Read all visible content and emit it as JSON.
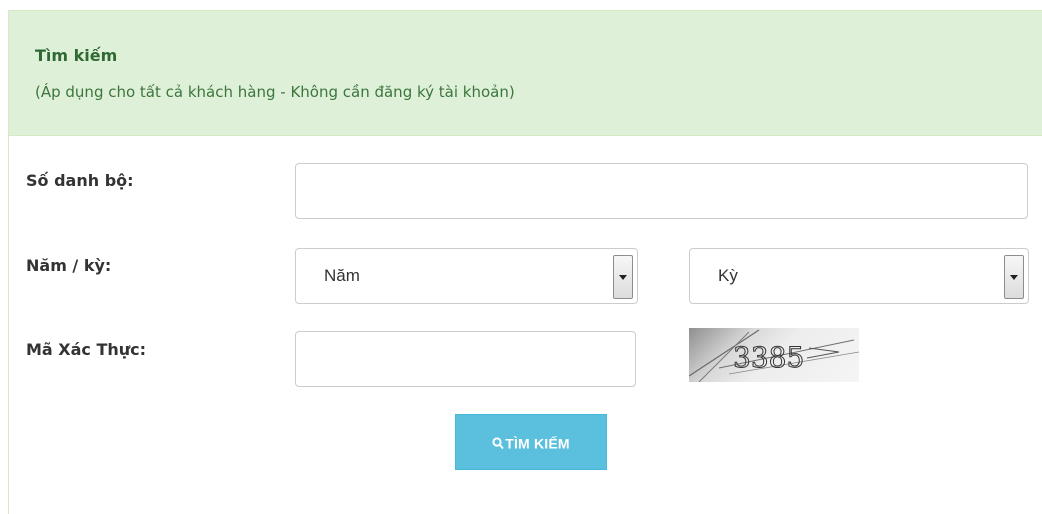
{
  "panel": {
    "title": "Tìm kiếm",
    "subtitle": "(Áp dụng cho tất cả khách hàng - Không cần đăng ký tài khoản)"
  },
  "form": {
    "account_label": "Số danh bộ:",
    "account_value": "",
    "period_label": "Năm / kỳ:",
    "year_select": "Năm",
    "period_select": "Kỳ",
    "captcha_label": "Mã Xác Thực:",
    "captcha_value": "",
    "captcha_text": "3385"
  },
  "actions": {
    "search_label": "TÌM KIẾM",
    "search_icon": "search-icon"
  },
  "colors": {
    "heading_bg": "#dff0d8",
    "heading_text": "#3c763d",
    "button_bg": "#5bc0de"
  }
}
